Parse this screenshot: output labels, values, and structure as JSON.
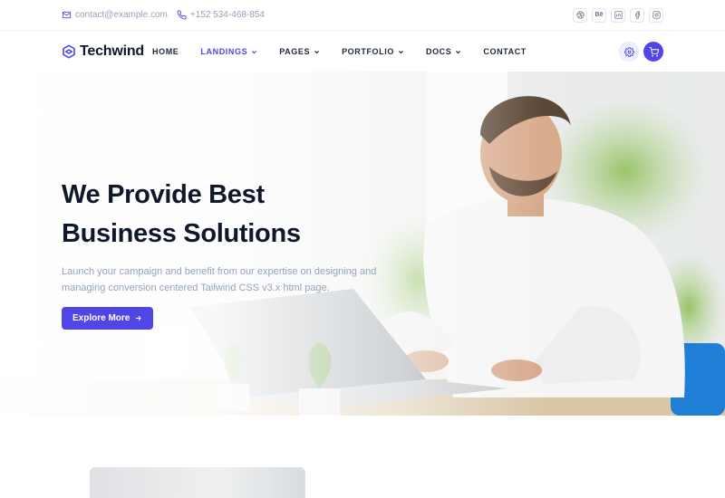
{
  "topbar": {
    "email": "contact@example.com",
    "phone": "+152 534-468-854",
    "socials": [
      "dribbble-icon",
      "behance-icon",
      "linkedin-icon",
      "facebook-icon",
      "instagram-icon"
    ],
    "behance_text": "Bē"
  },
  "nav": {
    "brand": "Techwind",
    "items": [
      {
        "label": "HOME",
        "dropdown": false,
        "active": false
      },
      {
        "label": "LANDINGS",
        "dropdown": true,
        "active": true
      },
      {
        "label": "PAGES",
        "dropdown": true,
        "active": false
      },
      {
        "label": "PORTFOLIO",
        "dropdown": true,
        "active": false
      },
      {
        "label": "DOCS",
        "dropdown": true,
        "active": false
      },
      {
        "label": "CONTACT",
        "dropdown": false,
        "active": false
      }
    ]
  },
  "hero": {
    "title_line1": "We Provide Best",
    "title_line2": "Business Solutions",
    "description": "Launch your campaign and benefit from our expertise on designing and managing conversion centered Tailwind CSS v3.x html page.",
    "cta_label": "Explore More"
  },
  "colors": {
    "accent": "#4f46e5",
    "text": "#0f172a",
    "muted": "#94a3b8"
  }
}
